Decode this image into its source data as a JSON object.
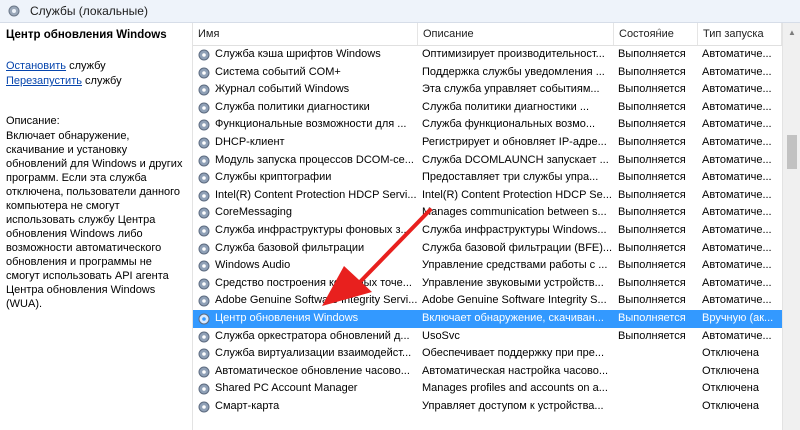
{
  "window": {
    "title": "Службы (локальные)"
  },
  "left_panel": {
    "service_name": "Центр обновления Windows",
    "stop_link": "Остановить",
    "stop_suffix": " службу",
    "restart_link": "Перезапустить",
    "restart_suffix": " службу",
    "description_label": "Описание:",
    "description_text": "Включает обнаружение, скачивание и установку обновлений для Windows и других программ. Если эта служба отключена, пользователи данного компьютера не смогут использовать службу Центра обновления Windows либо возможности автоматического обновления и программы не смогут использовать API агента Центра обновления Windows (WUA)."
  },
  "table": {
    "headers": {
      "name": "Имя",
      "description": "Описание",
      "state": "Состояние",
      "startup": "Тип запуска"
    },
    "sorted_column": "state",
    "rows": [
      {
        "name": "Служба кэша шрифтов Windows",
        "description": "Оптимизирует производительност...",
        "state": "Выполняется",
        "startup": "Автоматиче..."
      },
      {
        "name": "Система событий COM+",
        "description": "Поддержка службы уведомления ...",
        "state": "Выполняется",
        "startup": "Автоматиче..."
      },
      {
        "name": "Журнал событий Windows",
        "description": "Эта служба управляет событиям...",
        "state": "Выполняется",
        "startup": "Автоматиче..."
      },
      {
        "name": "Служба политики диагностики",
        "description": "Служба политики диагностики ...",
        "state": "Выполняется",
        "startup": "Автоматиче..."
      },
      {
        "name": "Функциональные возможности для ...",
        "description": "Служба функциональных возмо...",
        "state": "Выполняется",
        "startup": "Автоматиче..."
      },
      {
        "name": "DHCP-клиент",
        "description": "Регистрирует и обновляет IP-адре...",
        "state": "Выполняется",
        "startup": "Автоматиче..."
      },
      {
        "name": "Модуль запуска процессов DCOM-се...",
        "description": "Служба DCOMLAUNCH запускает ...",
        "state": "Выполняется",
        "startup": "Автоматиче..."
      },
      {
        "name": "Службы криптографии",
        "description": "Предоставляет три службы упра...",
        "state": "Выполняется",
        "startup": "Автоматиче..."
      },
      {
        "name": "Intel(R) Content Protection HDCP Servi...",
        "description": "Intel(R) Content Protection HDCP Se...",
        "state": "Выполняется",
        "startup": "Автоматиче..."
      },
      {
        "name": "CoreMessaging",
        "description": "Manages communication between s...",
        "state": "Выполняется",
        "startup": "Автоматиче..."
      },
      {
        "name": "Служба инфраструктуры фоновых з...",
        "description": "Служба инфраструктуры Windows...",
        "state": "Выполняется",
        "startup": "Автоматиче..."
      },
      {
        "name": "Служба базовой фильтрации",
        "description": "Служба базовой фильтрации (BFE)...",
        "state": "Выполняется",
        "startup": "Автоматиче..."
      },
      {
        "name": "Windows Audio",
        "description": "Управление средствами работы с ...",
        "state": "Выполняется",
        "startup": "Автоматиче..."
      },
      {
        "name": "Средство построения конечных точе...",
        "description": "Управление звуковыми устройств...",
        "state": "Выполняется",
        "startup": "Автоматиче..."
      },
      {
        "name": "Adobe Genuine Software Integrity Servi...",
        "description": "Adobe Genuine Software Integrity S...",
        "state": "Выполняется",
        "startup": "Автоматиче..."
      },
      {
        "name": "Центр обновления Windows",
        "description": "Включает обнаружение, скачиван...",
        "state": "Выполняется",
        "startup": "Вручную (ак...",
        "selected": true
      },
      {
        "name": "Служба оркестратора обновлений д...",
        "description": "UsoSvc",
        "state": "Выполняется",
        "startup": "Автоматиче..."
      },
      {
        "name": "Служба виртуализации взаимодейст...",
        "description": "Обеспечивает поддержку при пре...",
        "state": "",
        "startup": "Отключена"
      },
      {
        "name": "Автоматическое обновление часово...",
        "description": "Автоматическая настройка часово...",
        "state": "",
        "startup": "Отключена"
      },
      {
        "name": "Shared PC Account Manager",
        "description": "Manages profiles and accounts on a...",
        "state": "",
        "startup": "Отключена"
      },
      {
        "name": "Смарт-карта",
        "description": "Управляет доступом к устройства...",
        "state": "",
        "startup": "Отключена"
      }
    ]
  },
  "colors": {
    "selection": "#3399ff",
    "annotation_arrow": "#e8201e",
    "link": "#0645ad"
  },
  "icons": {
    "title": "gear-icon",
    "row": "service-gear-icon"
  }
}
